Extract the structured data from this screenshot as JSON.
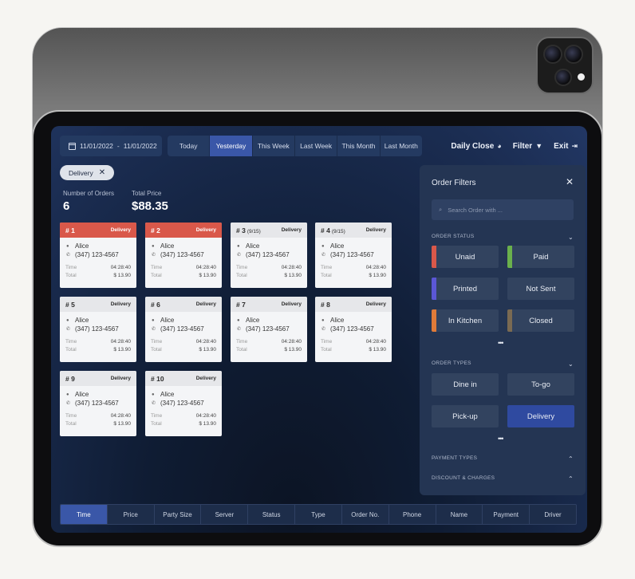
{
  "top_bar": {
    "date_from": "11/01/2022",
    "date_to": "11/01/2022",
    "date_separator": "-",
    "periods": [
      "Today",
      "Yesterday",
      "This Week",
      "Last Week",
      "This Month",
      "Last Month"
    ],
    "active_period": "Yesterday",
    "daily_close_label": "Daily Close",
    "filter_label": "Filter",
    "exit_label": "Exit"
  },
  "active_filter_chip": "Delivery",
  "summary": {
    "orders_label": "Number of Orders",
    "orders_value": "6",
    "price_label": "Total Price",
    "price_value": "$88.35"
  },
  "orders": [
    {
      "number": "# 1",
      "progress": "",
      "type": "Delivery",
      "highlight": true,
      "customer": "Alice",
      "phone": "(347) 123-4567",
      "time_label": "Time",
      "time": "04:28:40",
      "total_label": "Total",
      "total": "$ 13.90"
    },
    {
      "number": "# 2",
      "progress": "",
      "type": "Delivery",
      "highlight": true,
      "customer": "Alice",
      "phone": "(347) 123-4567",
      "time_label": "Time",
      "time": "04:28:40",
      "total_label": "Total",
      "total": "$ 13.90"
    },
    {
      "number": "# 3",
      "progress": "(9/15)",
      "type": "Delivery",
      "highlight": false,
      "customer": "Alice",
      "phone": "(347) 123-4567",
      "time_label": "Time",
      "time": "04:28:40",
      "total_label": "Total",
      "total": "$ 13.90"
    },
    {
      "number": "# 4",
      "progress": "(9/15)",
      "type": "Delivery",
      "highlight": false,
      "customer": "Alice",
      "phone": "(347) 123-4567",
      "time_label": "Time",
      "time": "04:28:40",
      "total_label": "Total",
      "total": "$ 13.90"
    },
    {
      "number": "# 5",
      "progress": "",
      "type": "Delivery",
      "highlight": false,
      "customer": "Alice",
      "phone": "(347) 123-4567",
      "time_label": "Time",
      "time": "04:28:40",
      "total_label": "Total",
      "total": "$ 13.90"
    },
    {
      "number": "# 6",
      "progress": "",
      "type": "Delivery",
      "highlight": false,
      "customer": "Alice",
      "phone": "(347) 123-4567",
      "time_label": "Time",
      "time": "04:28:40",
      "total_label": "Total",
      "total": "$ 13.90"
    },
    {
      "number": "# 7",
      "progress": "",
      "type": "Delivery",
      "highlight": false,
      "customer": "Alice",
      "phone": "(347) 123-4567",
      "time_label": "Time",
      "time": "04:28:40",
      "total_label": "Total",
      "total": "$ 13.90"
    },
    {
      "number": "# 8",
      "progress": "",
      "type": "Delivery",
      "highlight": false,
      "customer": "Alice",
      "phone": "(347) 123-4567",
      "time_label": "Time",
      "time": "04:28:40",
      "total_label": "Total",
      "total": "$ 13.90"
    },
    {
      "number": "# 9",
      "progress": "",
      "type": "Delivery",
      "highlight": false,
      "customer": "Alice",
      "phone": "(347) 123-4567",
      "time_label": "Time",
      "time": "04:28:40",
      "total_label": "Total",
      "total": "$ 13.90"
    },
    {
      "number": "# 10",
      "progress": "",
      "type": "Delivery",
      "highlight": false,
      "customer": "Alice",
      "phone": "(347) 123-4567",
      "time_label": "Time",
      "time": "04:28:40",
      "total_label": "Total",
      "total": "$ 13.90"
    }
  ],
  "filter_panel": {
    "title": "Order Filters",
    "search_placeholder": "Search Order with ...",
    "order_status_label": "ORDER STATUS",
    "statuses": [
      {
        "label": "Unaid",
        "color": "#d9584a"
      },
      {
        "label": "Paid",
        "color": "#6ab04c"
      },
      {
        "label": "Printed",
        "color": "#5b57d6"
      },
      {
        "label": "Not Sent",
        "color": ""
      },
      {
        "label": "In Kitchen",
        "color": "#e07b39"
      },
      {
        "label": "Closed",
        "color": "#7a6a52"
      }
    ],
    "more": "•••",
    "order_types_label": "ORDER TYPES",
    "types": [
      "Dine in",
      "To-go",
      "Pick-up",
      "Delivery"
    ],
    "active_type": "Delivery",
    "payment_types_label": "PAYMENT TYPES",
    "discount_label": "DISCOUNT & CHARGES"
  },
  "sort_columns": [
    "Time",
    "Price",
    "Party Size",
    "Server",
    "Status",
    "Type",
    "Order No.",
    "Phone",
    "Name",
    "Payment",
    "Driver"
  ],
  "active_sort": "Time"
}
